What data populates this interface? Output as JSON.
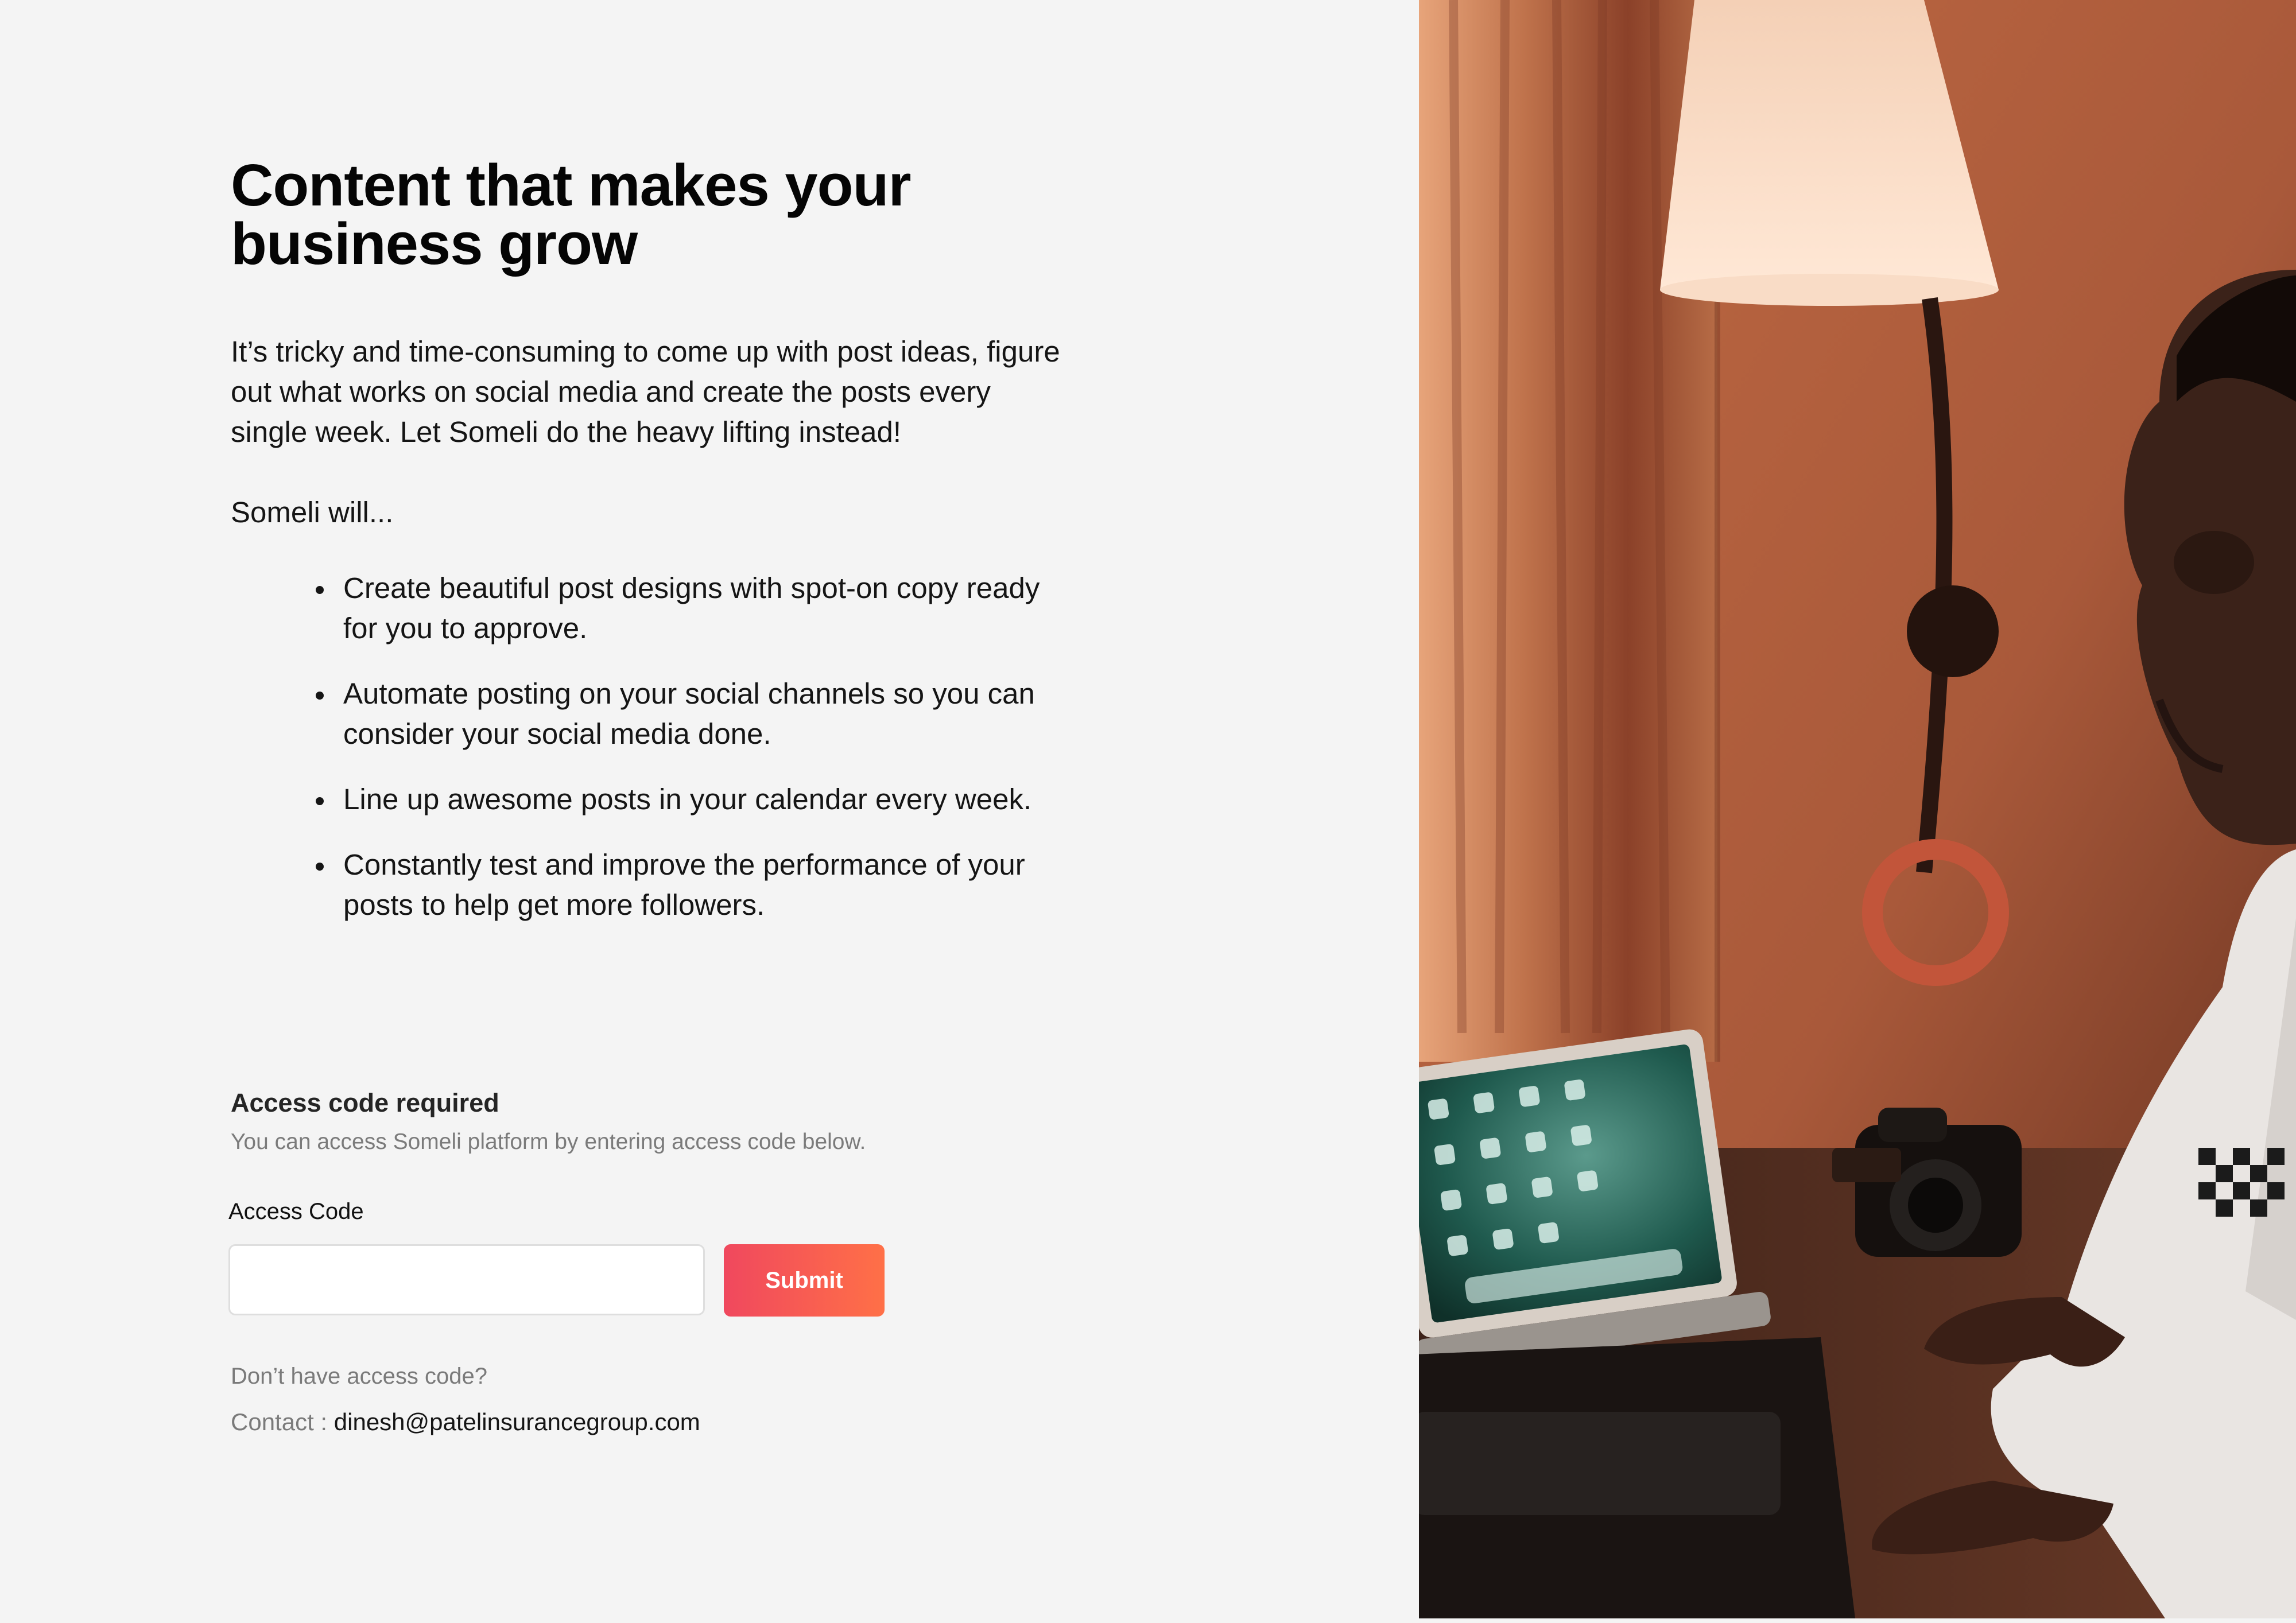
{
  "hero": {
    "title": "Content that makes your business grow",
    "intro": "It’s tricky and time-consuming to come up with post ideas, figure out what works on social media and create the posts every single week. Let Someli do the heavy lifting instead!",
    "will_label": "Someli will..."
  },
  "features": [
    {
      "text": "Create beautiful post designs with spot-on copy ready for you to approve."
    },
    {
      "text": "Automate posting on your social channels so you can consider your social media done."
    },
    {
      "text": "Line up awesome posts in your calendar every week."
    },
    {
      "text": "Constantly test and improve the performance of your posts to help get more followers."
    }
  ],
  "access": {
    "heading": "Access code required",
    "subheading": "You can access Someli platform by entering access code below.",
    "field_label": "Access Code",
    "input_value": "",
    "input_placeholder": "",
    "submit_label": "Submit",
    "no_code_text": "Don’t have access code?",
    "contact_label": "Contact : ",
    "contact_email": "dinesh@patelinsurancegroup.com"
  },
  "colors": {
    "background": "#f4f4f4",
    "submit_gradient_start": "#f0485e",
    "submit_gradient_end": "#ff7047"
  }
}
